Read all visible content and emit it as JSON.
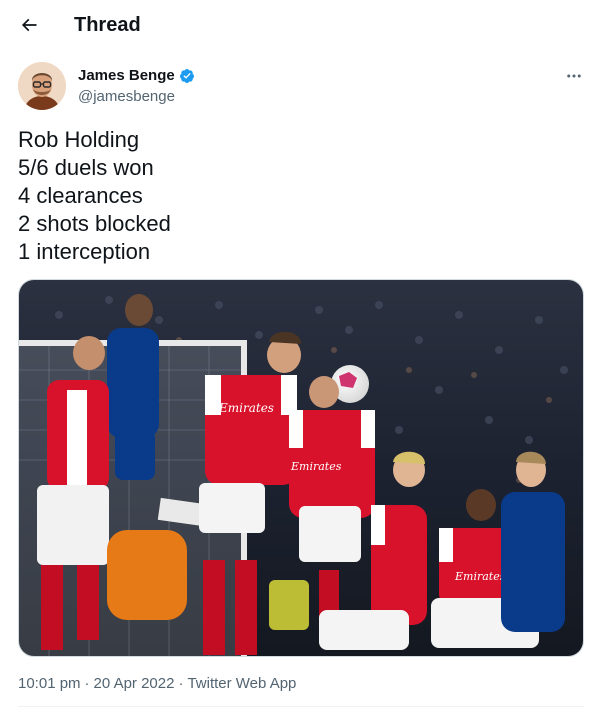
{
  "header": {
    "title": "Thread"
  },
  "tweet": {
    "author": {
      "name": "James Benge",
      "handle": "@jamesbenge",
      "verified": true
    },
    "text_lines": [
      "Rob Holding",
      "5/6 duels won",
      "4 clearances",
      "2 shots blocked",
      "1 interception"
    ],
    "meta": {
      "time": "10:01 pm",
      "separator_1": "·",
      "date": "20 Apr 2022",
      "separator_2": "·",
      "source": "Twitter Web App"
    }
  },
  "colors": {
    "accent": "#1d9bf0",
    "text": "#0f1419",
    "muted": "#536471",
    "arsenal_red": "#db0007",
    "chelsea_blue": "#034694"
  },
  "icons": {
    "back": "arrow-left-icon",
    "verified": "verified-badge-icon",
    "more": "more-horizontal-icon"
  }
}
